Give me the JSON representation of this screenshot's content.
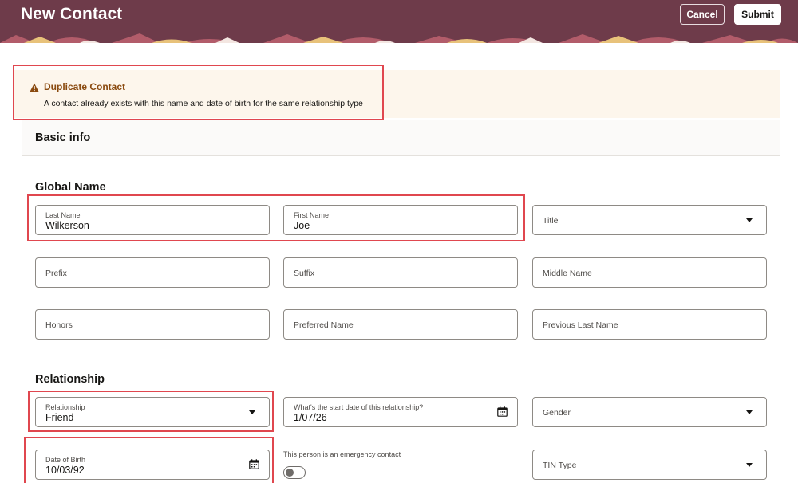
{
  "header": {
    "title": "New Contact",
    "cancel_label": "Cancel",
    "submit_label": "Submit"
  },
  "warning": {
    "title": "Duplicate Contact",
    "message": "A contact already exists with this name and date of birth for the same relationship type"
  },
  "card": {
    "title": "Basic info"
  },
  "global_name": {
    "title": "Global Name",
    "last_name": {
      "label": "Last Name",
      "value": "Wilkerson"
    },
    "first_name": {
      "label": "First Name",
      "value": "Joe"
    },
    "title_field": {
      "placeholder": "Title"
    },
    "prefix": {
      "placeholder": "Prefix"
    },
    "suffix": {
      "placeholder": "Suffix"
    },
    "middle_name": {
      "placeholder": "Middle Name"
    },
    "honors": {
      "placeholder": "Honors"
    },
    "preferred_name": {
      "placeholder": "Preferred Name"
    },
    "previous_last_name": {
      "placeholder": "Previous Last Name"
    }
  },
  "relationship": {
    "title": "Relationship",
    "relationship_field": {
      "label": "Relationship",
      "value": "Friend"
    },
    "start_date": {
      "label": "What's the start date of this relationship?",
      "value": "1/07/26"
    },
    "gender": {
      "placeholder": "Gender"
    },
    "date_of_birth": {
      "label": "Date of Birth",
      "value": "10/03/92"
    },
    "emergency_contact_label": "This person is an emergency contact",
    "emergency_contact_on": false,
    "tin_type": {
      "placeholder": "TIN Type"
    }
  },
  "colors": {
    "header_bg": "#6e3b4a",
    "highlight": "#e0474f",
    "warning_bg": "#fdf6ec",
    "warning_title": "#8a4a0f"
  }
}
